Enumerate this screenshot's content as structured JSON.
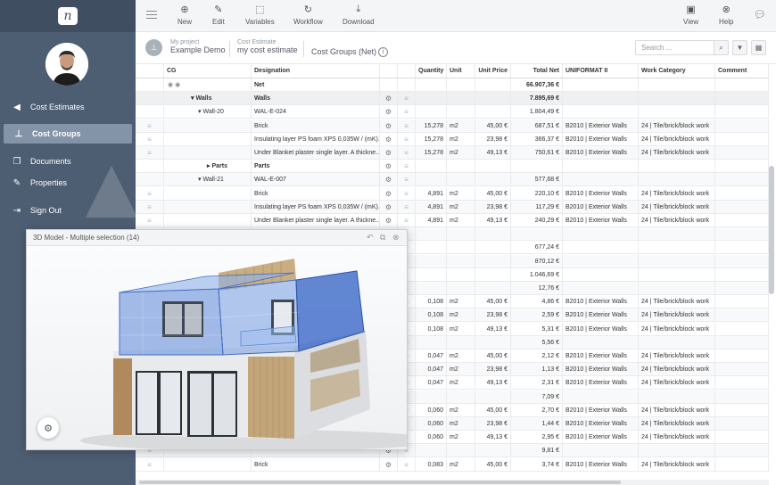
{
  "sidebar": {
    "logo": "n",
    "items": [
      {
        "label": "Cost Estimates",
        "icon": "triangle-left-icon"
      },
      {
        "label": "Cost Groups",
        "icon": "hierarchy-icon"
      },
      {
        "label": "Documents",
        "icon": "documents-icon"
      },
      {
        "label": "Properties",
        "icon": "pencil-icon"
      },
      {
        "label": "Sign Out",
        "icon": "sign-out-icon"
      }
    ]
  },
  "toolbar": {
    "new": "New",
    "edit": "Edit",
    "variables": "Variables",
    "workflow": "Workflow",
    "download": "Download",
    "view": "View",
    "help": "Help"
  },
  "breadcrumb": {
    "project_label": "My project",
    "project_value": "Example Demo",
    "estimate_label": "Cost Estimate",
    "estimate_value": "my cost estimate",
    "group": "Cost Groups (Net)"
  },
  "search": {
    "placeholder": "Search ..."
  },
  "table": {
    "headers": [
      "CG",
      "Designation",
      "Quantity",
      "Unit",
      "Unit Price",
      "Total Net",
      "UNIFORMAT II",
      "Work Category",
      "Comment"
    ],
    "rows": [
      {
        "cg": "",
        "des": "Net",
        "qty": "",
        "unit": "",
        "up": "",
        "total": "66.907,36 €",
        "uf": "",
        "wc": "",
        "type": "net"
      },
      {
        "cg": "Walls",
        "des": "Walls",
        "qty": "",
        "unit": "",
        "up": "",
        "total": "7.895,69 €",
        "uf": "",
        "wc": "",
        "type": "grp1"
      },
      {
        "cg": "Wall-20",
        "des": "WAL-E-024",
        "qty": "",
        "unit": "",
        "up": "",
        "total": "1.804,49 €",
        "uf": "",
        "wc": "",
        "type": "grp2"
      },
      {
        "cg": "",
        "des": "Brick",
        "qty": "15,278",
        "unit": "m2",
        "up": "45,00 €",
        "total": "687,51 €",
        "uf": "B2010 | Exterior Walls",
        "wc": "24 | Tile/brick/block work",
        "type": "item"
      },
      {
        "cg": "",
        "des": "Insulating layer PS foam XPS 0,035W / (mK)...",
        "qty": "15,278",
        "unit": "m2",
        "up": "23,98 €",
        "total": "366,37 €",
        "uf": "B2010 | Exterior Walls",
        "wc": "24 | Tile/brick/block work",
        "type": "item"
      },
      {
        "cg": "",
        "des": "Under Blanket plaster single layer. A thickne...",
        "qty": "15,278",
        "unit": "m2",
        "up": "49,13 €",
        "total": "750,61 €",
        "uf": "B2010 | Exterior Walls",
        "wc": "24 | Tile/brick/block work",
        "type": "item"
      },
      {
        "cg": "Parts",
        "des": "Parts",
        "qty": "",
        "unit": "",
        "up": "",
        "total": "",
        "uf": "",
        "wc": "",
        "type": "grp3"
      },
      {
        "cg": "Wall-21",
        "des": "WAL-E-007",
        "qty": "",
        "unit": "",
        "up": "",
        "total": "577,68 €",
        "uf": "",
        "wc": "",
        "type": "grp2"
      },
      {
        "cg": "",
        "des": "Brick",
        "qty": "4,891",
        "unit": "m2",
        "up": "45,00 €",
        "total": "220,10 €",
        "uf": "B2010 | Exterior Walls",
        "wc": "24 | Tile/brick/block work",
        "type": "item"
      },
      {
        "cg": "",
        "des": "Insulating layer PS foam XPS 0,035W / (mK)...",
        "qty": "4,891",
        "unit": "m2",
        "up": "23,98 €",
        "total": "117,29 €",
        "uf": "B2010 | Exterior Walls",
        "wc": "24 | Tile/brick/block work",
        "type": "item"
      },
      {
        "cg": "",
        "des": "Under Blanket plaster single layer. A thickne...",
        "qty": "4,891",
        "unit": "m2",
        "up": "49,13 €",
        "total": "240,29 €",
        "uf": "B2010 | Exterior Walls",
        "wc": "24 | Tile/brick/block work",
        "type": "item"
      },
      {
        "cg": "",
        "des": "",
        "qty": "",
        "unit": "",
        "up": "",
        "total": "",
        "uf": "",
        "wc": "",
        "type": "item"
      },
      {
        "cg": "",
        "des": "",
        "qty": "",
        "unit": "",
        "up": "",
        "total": "677,24 €",
        "uf": "",
        "wc": "",
        "type": "item"
      },
      {
        "cg": "",
        "des": "",
        "qty": "",
        "unit": "",
        "up": "",
        "total": "870,12 €",
        "uf": "",
        "wc": "",
        "type": "item"
      },
      {
        "cg": "",
        "des": "",
        "qty": "",
        "unit": "",
        "up": "",
        "total": "1.046,69 €",
        "uf": "",
        "wc": "",
        "type": "item"
      },
      {
        "cg": "",
        "des": "",
        "qty": "",
        "unit": "",
        "up": "",
        "total": "12,76 €",
        "uf": "",
        "wc": "",
        "type": "item"
      },
      {
        "cg": "",
        "des": "",
        "qty": "0,108",
        "unit": "m2",
        "up": "45,00 €",
        "total": "4,86 €",
        "uf": "B2010 | Exterior Walls",
        "wc": "24 | Tile/brick/block work",
        "type": "item"
      },
      {
        "cg": "",
        "des": "",
        "qty": "0,108",
        "unit": "m2",
        "up": "23,98 €",
        "total": "2,59 €",
        "uf": "B2010 | Exterior Walls",
        "wc": "24 | Tile/brick/block work",
        "type": "item"
      },
      {
        "cg": "",
        "des": "",
        "qty": "0,108",
        "unit": "m2",
        "up": "49,13 €",
        "total": "5,31 €",
        "uf": "B2010 | Exterior Walls",
        "wc": "24 | Tile/brick/block work",
        "type": "item"
      },
      {
        "cg": "",
        "des": "",
        "qty": "",
        "unit": "",
        "up": "",
        "total": "5,56 €",
        "uf": "",
        "wc": "",
        "type": "item"
      },
      {
        "cg": "",
        "des": "",
        "qty": "0,047",
        "unit": "m2",
        "up": "45,00 €",
        "total": "2,12 €",
        "uf": "B2010 | Exterior Walls",
        "wc": "24 | Tile/brick/block work",
        "type": "item"
      },
      {
        "cg": "",
        "des": "",
        "qty": "0,047",
        "unit": "m2",
        "up": "23,98 €",
        "total": "1,13 €",
        "uf": "B2010 | Exterior Walls",
        "wc": "24 | Tile/brick/block work",
        "type": "item"
      },
      {
        "cg": "",
        "des": "",
        "qty": "0,047",
        "unit": "m2",
        "up": "49,13 €",
        "total": "2,31 €",
        "uf": "B2010 | Exterior Walls",
        "wc": "24 | Tile/brick/block work",
        "type": "item"
      },
      {
        "cg": "",
        "des": "",
        "qty": "",
        "unit": "",
        "up": "",
        "total": "7,09 €",
        "uf": "",
        "wc": "",
        "type": "item"
      },
      {
        "cg": "",
        "des": "",
        "qty": "0,060",
        "unit": "m2",
        "up": "45,00 €",
        "total": "2,70 €",
        "uf": "B2010 | Exterior Walls",
        "wc": "24 | Tile/brick/block work",
        "type": "item"
      },
      {
        "cg": "",
        "des": "",
        "qty": "0,060",
        "unit": "m2",
        "up": "23,98 €",
        "total": "1,44 €",
        "uf": "B2010 | Exterior Walls",
        "wc": "24 | Tile/brick/block work",
        "type": "item"
      },
      {
        "cg": "",
        "des": "",
        "qty": "0,060",
        "unit": "m2",
        "up": "49,13 €",
        "total": "2,95 €",
        "uf": "B2010 | Exterior Walls",
        "wc": "24 | Tile/brick/block work",
        "type": "item"
      },
      {
        "cg": "",
        "des": "",
        "qty": "",
        "unit": "",
        "up": "",
        "total": "9,81 €",
        "uf": "",
        "wc": "",
        "type": "item"
      },
      {
        "cg": "",
        "des": "Brick",
        "qty": "0,083",
        "unit": "m2",
        "up": "45,00 €",
        "total": "3,74 €",
        "uf": "B2010 | Exterior Walls",
        "wc": "24 | Tile/brick/block work",
        "type": "item"
      }
    ]
  },
  "panel": {
    "title": "3D Model - Multiple selection (14)"
  },
  "colors": {
    "sidebar": "#4e5e72",
    "active": "#8494a8",
    "selection": "#5b86d8"
  }
}
